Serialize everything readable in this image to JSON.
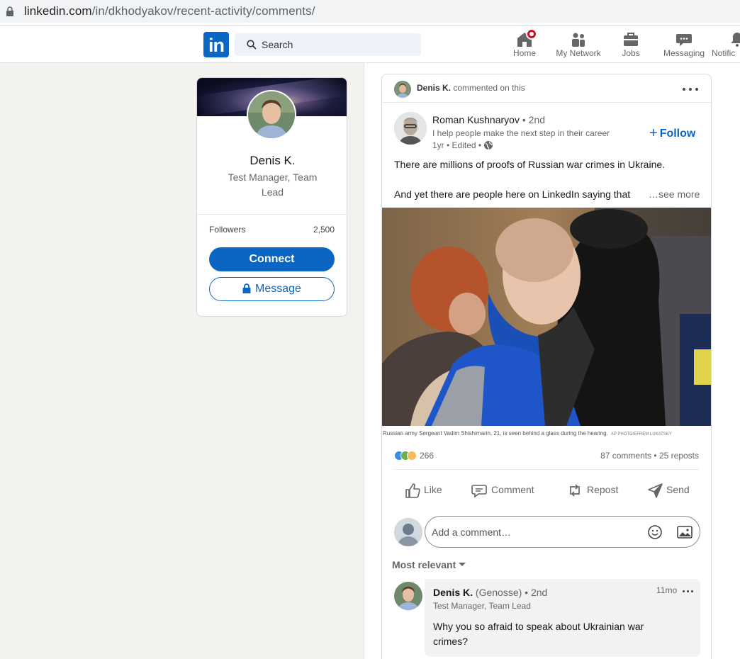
{
  "browser": {
    "url_host": "linkedin.com",
    "url_path": "/in/dkhodyakov/recent-activity/comments/"
  },
  "nav": {
    "logo_text": "in",
    "search_placeholder": "Search",
    "items": [
      {
        "label": "Home",
        "icon": "home-icon"
      },
      {
        "label": "My Network",
        "icon": "people-icon"
      },
      {
        "label": "Jobs",
        "icon": "briefcase-icon"
      },
      {
        "label": "Messaging",
        "icon": "chat-icon"
      },
      {
        "label": "Notific",
        "icon": "bell-icon"
      }
    ]
  },
  "profile": {
    "name": "Denis K.",
    "title": "Test Manager, Team Lead",
    "followers_label": "Followers",
    "followers_value": "2,500",
    "connect_label": "Connect",
    "message_label": "Message"
  },
  "post": {
    "activity_name": "Denis K.",
    "activity_text": "commented on this",
    "author_name": "Roman Kushnaryov",
    "author_degree": "• 2nd",
    "author_headline": "I help people make the next step in their career",
    "author_meta": "1yr • Edited •",
    "follow_label": "Follow",
    "text_line1": "There are millions of proofs of Russian war crimes in Ukraine.",
    "text_line2": "And yet there are people here on LinkedIn saying that",
    "see_more": "…see more",
    "photo_caption": "Russian army Sergeant Vadim Shishimarin, 21, is seen behind a glass during the hearing.",
    "photo_credit": "AP PHOTO/EFREM LUKATSKY",
    "reaction_count": "266",
    "stats": "87 comments • 25 reposts",
    "actions": {
      "like": "Like",
      "comment": "Comment",
      "repost": "Repost",
      "send": "Send"
    },
    "comment_placeholder": "Add a comment…",
    "sort_label": "Most relevant",
    "comment": {
      "name": "Denis K.",
      "alias": "(Genosse)",
      "degree": "• 2nd",
      "headline": "Test Manager, Team Lead",
      "time": "11mo",
      "text": "Why you so afraid to speak about Ukrainian war crimes?"
    }
  },
  "colors": {
    "brand": "#0a66c2",
    "notification": "#cb112d",
    "background": "#f3f2ef"
  }
}
